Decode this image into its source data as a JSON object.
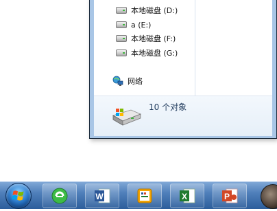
{
  "nav_pane": {
    "drives": [
      {
        "label": "本地磁盘 (D:)",
        "icon": "hard-drive-icon"
      },
      {
        "label": "a (E:)",
        "icon": "hard-drive-icon"
      },
      {
        "label": "本地磁盘 (F:)",
        "icon": "hard-drive-icon"
      },
      {
        "label": "本地磁盘 (G:)",
        "icon": "hard-drive-icon"
      }
    ],
    "network": {
      "label": "网络",
      "icon": "network-icon"
    }
  },
  "details_pane": {
    "count_text": "10 个对象",
    "icon": "computer-drive-icon"
  },
  "taskbar": {
    "start": {
      "icon": "windows-start-orb-icon"
    },
    "apps": [
      {
        "name": "ie-browser",
        "icon": "internet-explorer-icon",
        "color": "#3dbb45"
      },
      {
        "name": "word",
        "icon": "word-icon",
        "color": "#2b5797"
      },
      {
        "name": "image-viewer",
        "icon": "image-viewer-icon",
        "color": "#f4a400"
      },
      {
        "name": "excel",
        "icon": "excel-icon",
        "color": "#1f7a2f"
      },
      {
        "name": "powerpoint",
        "icon": "powerpoint-icon",
        "color": "#d24726"
      },
      {
        "name": "user",
        "icon": "avatar-icon"
      }
    ]
  }
}
